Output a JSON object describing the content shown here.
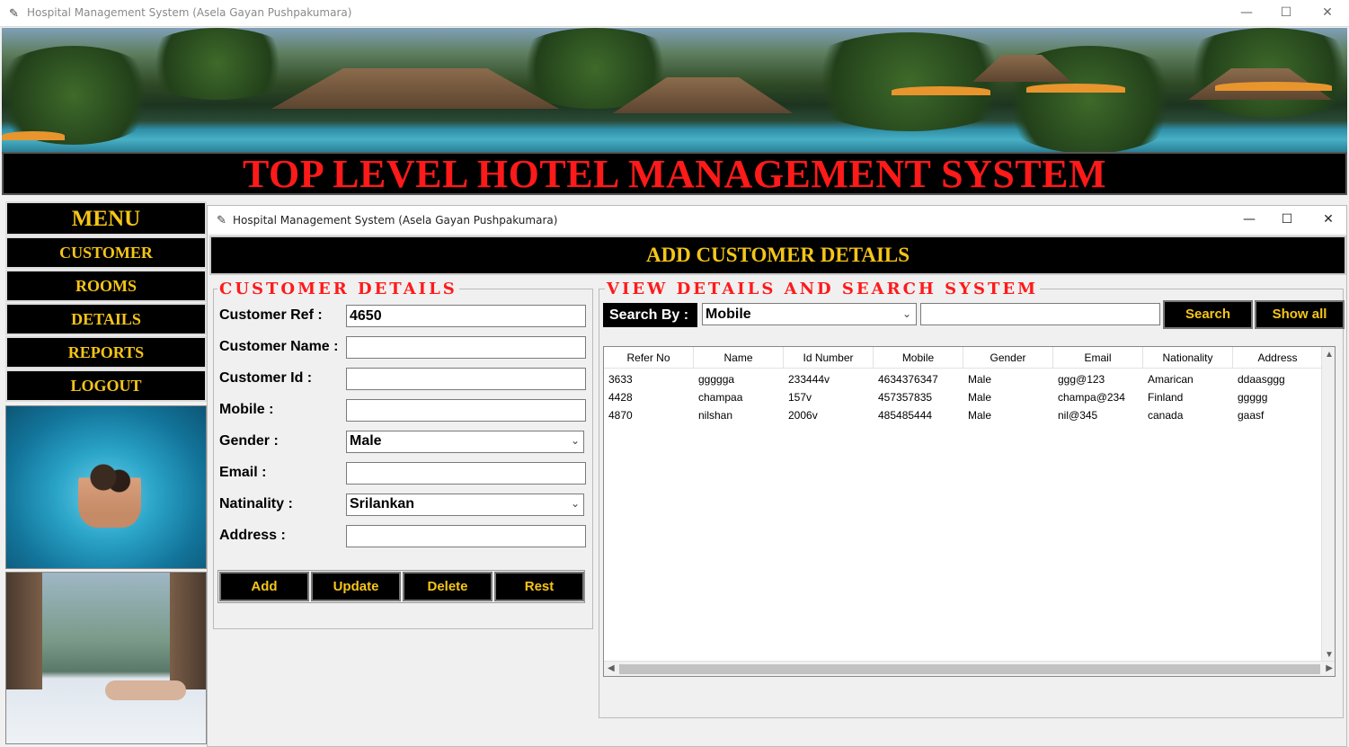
{
  "window": {
    "title": "Hospital Management System (Asela Gayan Pushpakumara)",
    "minimize": "—",
    "maximize": "☐",
    "close": "✕"
  },
  "banner": {
    "title": "TOP LEVEL HOTEL MANAGEMENT SYSTEM"
  },
  "menu": {
    "header": "MENU",
    "items": [
      {
        "label": "CUSTOMER"
      },
      {
        "label": "ROOMS"
      },
      {
        "label": "DETAILS"
      },
      {
        "label": "REPORTS"
      },
      {
        "label": "LOGOUT"
      }
    ]
  },
  "inner_window": {
    "title": "Hospital Management System (Asela Gayan Pushpakumara)",
    "minimize": "—",
    "maximize": "☐",
    "close": "✕",
    "header": "ADD CUSTOMER DETAILS"
  },
  "customer_form": {
    "legend": "CUSTOMER DETAILS",
    "ref_label": "Customer Ref :",
    "ref_value": "4650",
    "name_label": "Customer Name :",
    "name_value": "",
    "id_label": "Customer Id :",
    "id_value": "",
    "mobile_label": "Mobile :",
    "mobile_value": "",
    "gender_label": "Gender :",
    "gender_value": "Male",
    "email_label": "Email :",
    "email_value": "",
    "nationality_label": "Natinality :",
    "nationality_value": "Srilankan",
    "address_label": "Address :",
    "address_value": "",
    "buttons": {
      "add": "Add",
      "update": "Update",
      "delete": "Delete",
      "reset": "Rest"
    }
  },
  "view": {
    "legend": "VIEW DETAILS AND SEARCH SYSTEM",
    "search_by_label": "Search By :",
    "search_by_value": "Mobile",
    "search_text": "",
    "search_button": "Search",
    "show_all_button": "Show all",
    "columns": [
      "Refer No",
      "Name",
      "Id Number",
      "Mobile",
      "Gender",
      "Email",
      "Nationality",
      "Address"
    ],
    "rows": [
      [
        "3633",
        "ggggga",
        "233444v",
        "4634376347",
        "Male",
        "ggg@123",
        "Amarican",
        "ddaasggg"
      ],
      [
        "4428",
        "champaa",
        "157v",
        "457357835",
        "Male",
        "champa@234",
        "Finland",
        "ggggg"
      ],
      [
        "4870",
        "nilshan",
        "2006v",
        "485485444",
        "Male",
        "nil@345",
        "canada",
        "gaasf"
      ]
    ]
  },
  "colors": {
    "title_red": "#ff1a1a",
    "menu_gold": "#f5c518",
    "button_black": "#000000"
  }
}
